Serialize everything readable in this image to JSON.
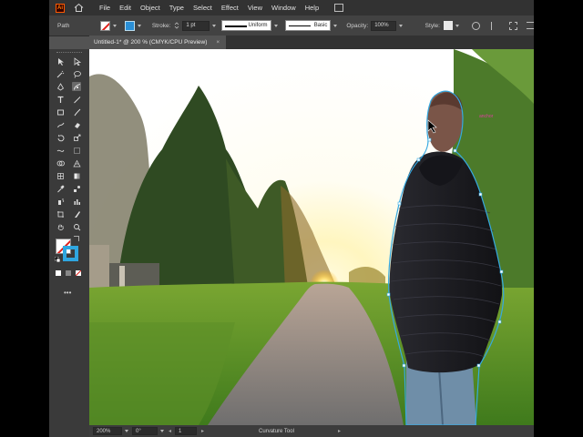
{
  "app": {
    "logo_text": "Ai",
    "menus": [
      "File",
      "Edit",
      "Object",
      "Type",
      "Select",
      "Effect",
      "View",
      "Window",
      "Help"
    ]
  },
  "control_bar": {
    "selection_label": "Path",
    "stroke_label": "Stroke:",
    "stroke_weight": "1 pt",
    "variable_width_profile": "Uniform",
    "brush_definition": "Basic",
    "opacity_label": "Opacity:",
    "opacity_value": "100%",
    "style_label": "Style:"
  },
  "document_tab": {
    "title": "Untitled-1* @ 200 % (CMYK/CPU Preview)",
    "close": "×"
  },
  "canvas": {
    "anchor_label": "anchor"
  },
  "status_bar": {
    "zoom": "200%",
    "rotation": "0°",
    "artboard": "1",
    "current_tool": "Curvature Tool"
  },
  "colors": {
    "accent": "#2fa6e0",
    "path_selection": "#36a9e1",
    "none_slash": "#e0201a"
  },
  "icons": {
    "tools": [
      "selection-tool-icon",
      "direct-selection-tool-icon",
      "magic-wand-tool-icon",
      "lasso-tool-icon",
      "pen-tool-icon",
      "curvature-tool-icon",
      "type-tool-icon",
      "line-segment-tool-icon",
      "rectangle-tool-icon",
      "paintbrush-tool-icon",
      "shaper-tool-icon",
      "eraser-tool-icon",
      "rotate-tool-icon",
      "scale-tool-icon",
      "width-tool-icon",
      "free-transform-tool-icon",
      "shape-builder-tool-icon",
      "perspective-grid-tool-icon",
      "mesh-tool-icon",
      "gradient-tool-icon",
      "eyedropper-tool-icon",
      "blend-tool-icon",
      "symbol-sprayer-tool-icon",
      "column-graph-tool-icon",
      "artboard-tool-icon",
      "slice-tool-icon",
      "hand-tool-icon",
      "zoom-tool-icon"
    ]
  }
}
